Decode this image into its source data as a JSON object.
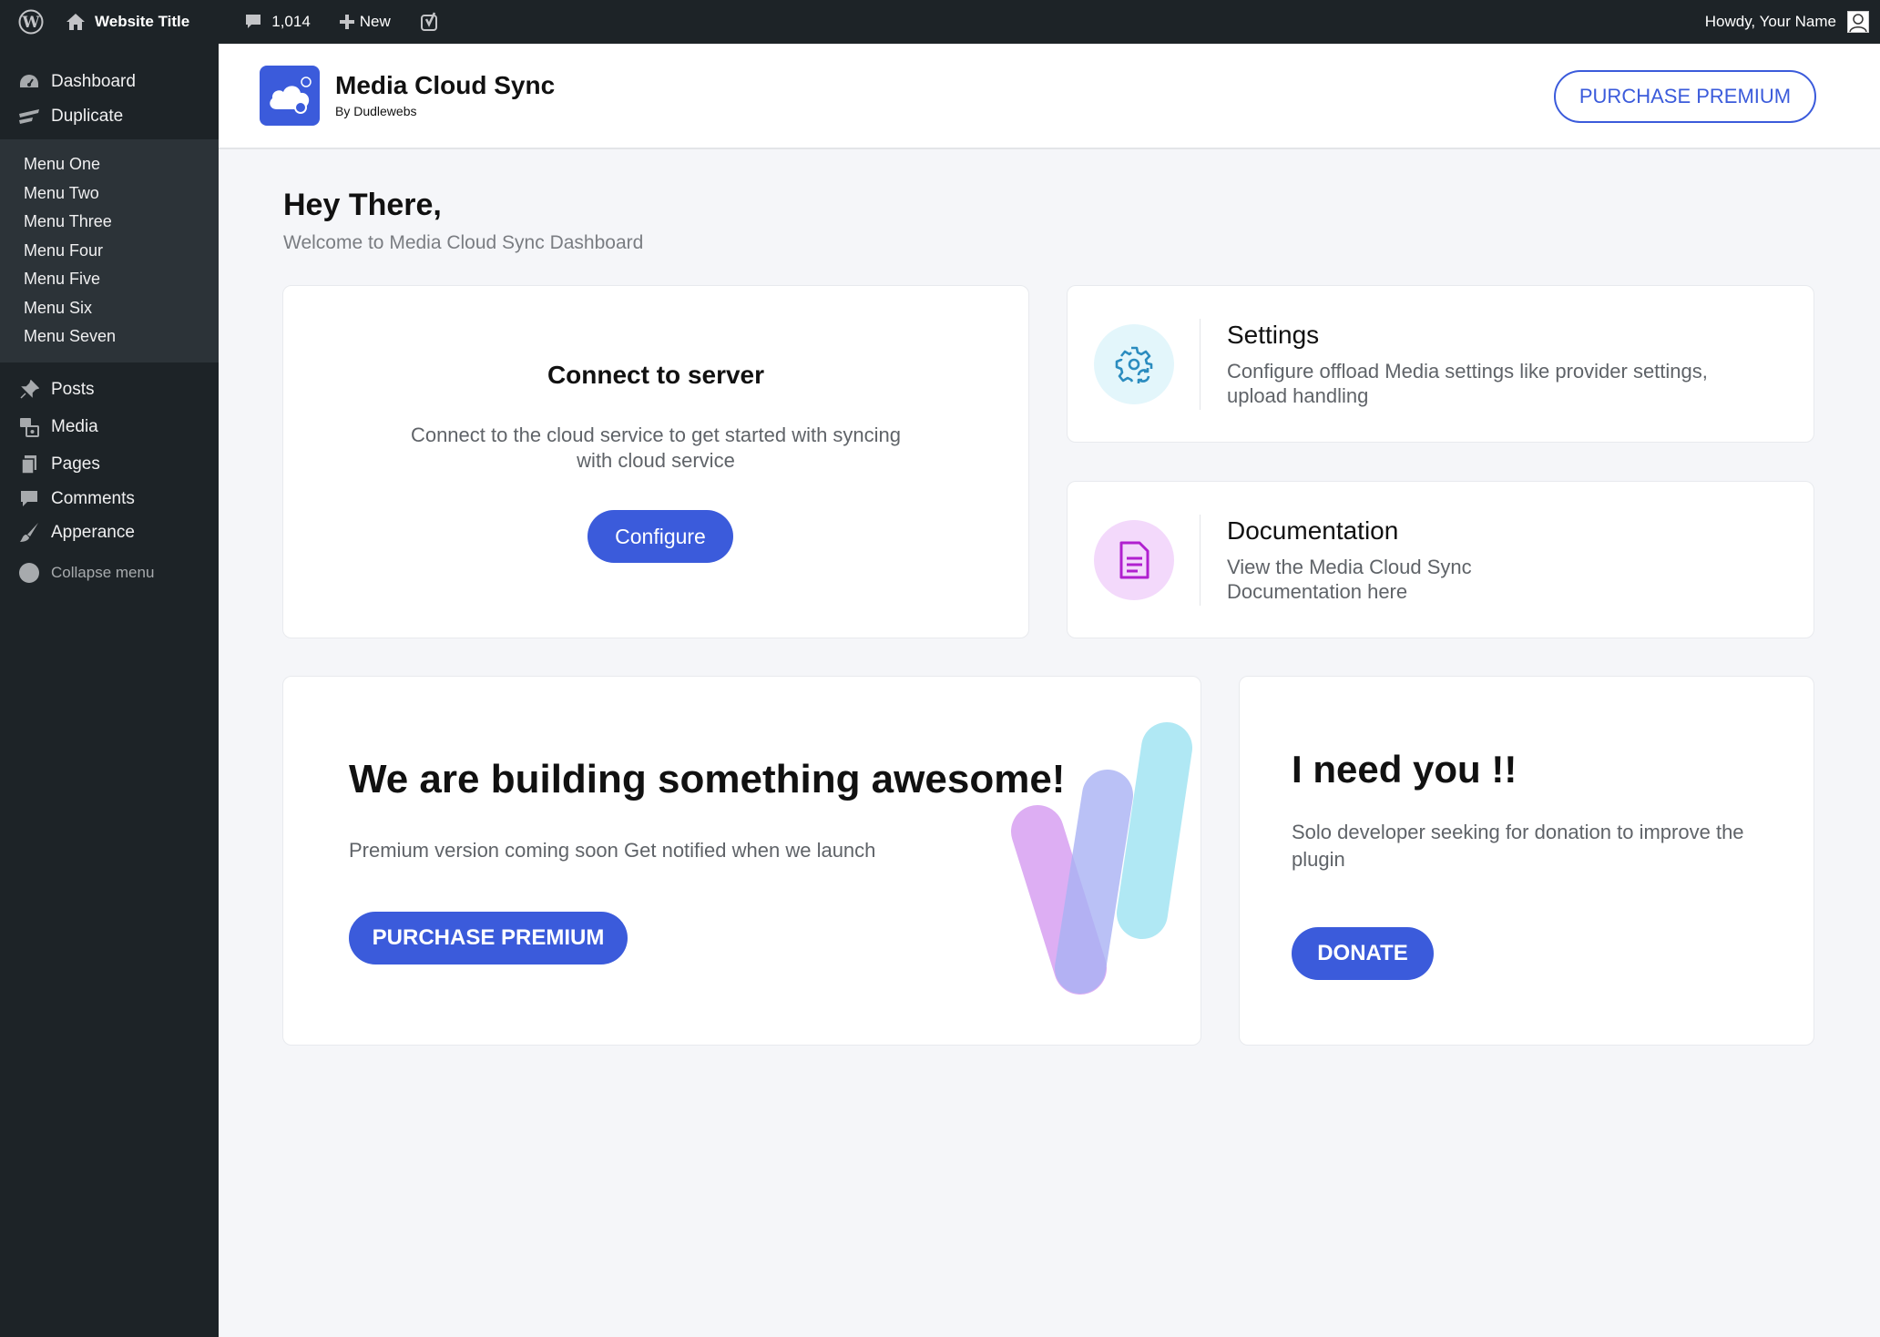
{
  "adminbar": {
    "site_title": "Website Title",
    "comments_count": "1,014",
    "new_label": "New",
    "howdy": "Howdy, Your Name"
  },
  "sidebar": {
    "dashboard": "Dashboard",
    "duplicate": "Duplicate",
    "submenu": [
      "Menu One",
      "Menu Two",
      "Menu Three",
      "Menu Four",
      "Menu Five",
      "Menu Six",
      "Menu Seven"
    ],
    "posts": "Posts",
    "media": "Media",
    "pages": "Pages",
    "comments": "Comments",
    "appearance": "Apperance",
    "collapse": "Collapse menu"
  },
  "header": {
    "title": "Media Cloud Sync",
    "subtitle": "By Dudlewebs",
    "purchase_label": "PURCHASE PREMIUM"
  },
  "main": {
    "greeting": "Hey There,",
    "welcome": "Welcome to Media Cloud Sync Dashboard",
    "connect": {
      "title": "Connect to server",
      "description": "Connect to the cloud service to get started with syncing with cloud service",
      "button": "Configure"
    },
    "settings": {
      "title": "Settings",
      "description": "Configure offload Media settings like provider settings, upload handling"
    },
    "docs": {
      "title": "Documentation",
      "description": "View the Media Cloud Sync Documentation here"
    },
    "build": {
      "title": "We are building something awesome!",
      "description": "Premium version coming soon Get notified when we launch",
      "button": "PURCHASE PREMIUM"
    },
    "donate": {
      "title": "I need you !!",
      "description": "Solo developer seeking for donation to improve the plugin",
      "button": "DONATE"
    }
  },
  "colors": {
    "primary": "#3b5bdb",
    "adminbar": "#1d2327",
    "submenu_bg": "#2c3338",
    "settings_icon_bg": "#e3f6fb",
    "docs_icon_bg": "#f3d9fb"
  },
  "icons": {
    "wp": "wordpress-logo-icon",
    "home": "home-icon",
    "comment": "comment-bubble-icon",
    "plus": "plus-icon",
    "seo": "yoast-seo-icon",
    "settings": "gear-sync-icon",
    "docs": "document-icon",
    "cloud": "cloud-logo-icon"
  }
}
